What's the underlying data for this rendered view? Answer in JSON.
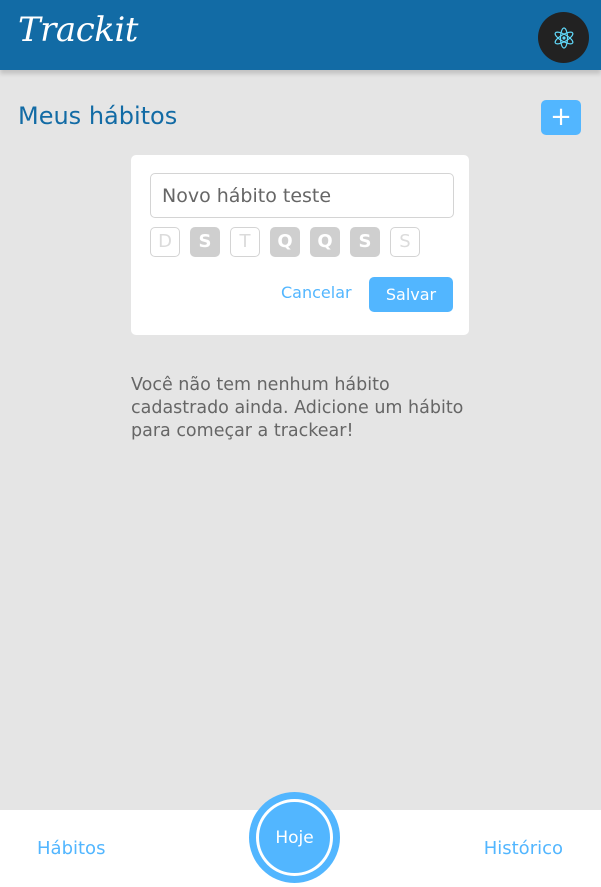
{
  "header": {
    "logo": "Trackit",
    "avatar_icon": "react-atom-icon"
  },
  "page": {
    "title": "Meus hábitos",
    "add_button": "+"
  },
  "form": {
    "habit_name_value": "Novo hábito teste",
    "days": [
      {
        "label": "D",
        "selected": false
      },
      {
        "label": "S",
        "selected": true
      },
      {
        "label": "T",
        "selected": false
      },
      {
        "label": "Q",
        "selected": true
      },
      {
        "label": "Q",
        "selected": true
      },
      {
        "label": "S",
        "selected": true
      },
      {
        "label": "S",
        "selected": false
      }
    ],
    "cancel_label": "Cancelar",
    "save_label": "Salvar"
  },
  "empty_message": "Você não tem nenhum hábito cadastrado ainda. Adicione um hábito para começar a trackear!",
  "footer": {
    "habits_label": "Hábitos",
    "today_label": "Hoje",
    "history_label": "Histórico"
  },
  "colors": {
    "header": "#126ba5",
    "accent": "#52b6ff",
    "background": "#e5e5e5",
    "day_selected": "#cfcfcf"
  }
}
